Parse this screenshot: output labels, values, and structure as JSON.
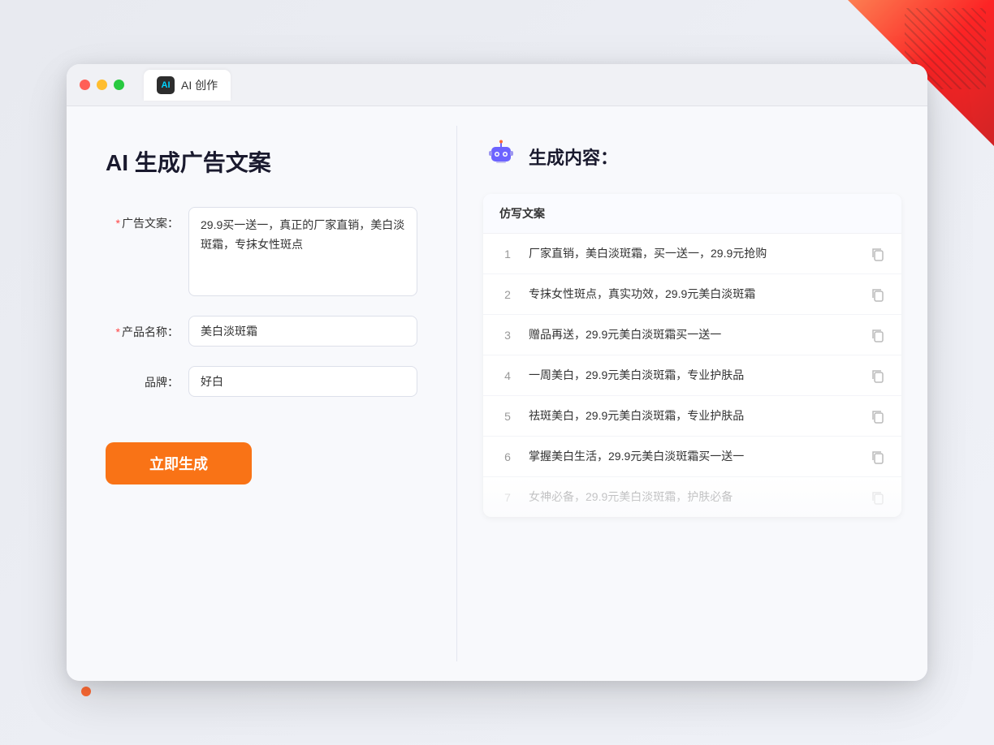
{
  "decorations": {
    "corner": "top-right-triangle"
  },
  "browser": {
    "tab": {
      "title": "AI 创作",
      "icon_label": "AI"
    }
  },
  "left_panel": {
    "page_title": "AI 生成广告文案",
    "form": {
      "ad_copy_label": "广告文案：",
      "ad_copy_required": "*",
      "ad_copy_value": "29.9买一送一，真正的厂家直销，美白淡斑霜，专抹女性斑点",
      "product_name_label": "产品名称：",
      "product_name_required": "*",
      "product_name_value": "美白淡斑霜",
      "brand_label": "品牌：",
      "brand_value": "好白"
    },
    "generate_button": "立即生成"
  },
  "right_panel": {
    "header_title": "生成内容：",
    "table_header": "仿写文案",
    "results": [
      {
        "id": 1,
        "text": "厂家直销，美白淡斑霜，买一送一，29.9元抢购"
      },
      {
        "id": 2,
        "text": "专抹女性斑点，真实功效，29.9元美白淡斑霜"
      },
      {
        "id": 3,
        "text": "赠品再送，29.9元美白淡斑霜买一送一"
      },
      {
        "id": 4,
        "text": "一周美白，29.9元美白淡斑霜，专业护肤品"
      },
      {
        "id": 5,
        "text": "祛斑美白，29.9元美白淡斑霜，专业护肤品"
      },
      {
        "id": 6,
        "text": "掌握美白生活，29.9元美白淡斑霜买一送一"
      },
      {
        "id": 7,
        "text": "女神必备，29.9元美白淡斑霜，护肤必备",
        "faded": true
      }
    ]
  }
}
